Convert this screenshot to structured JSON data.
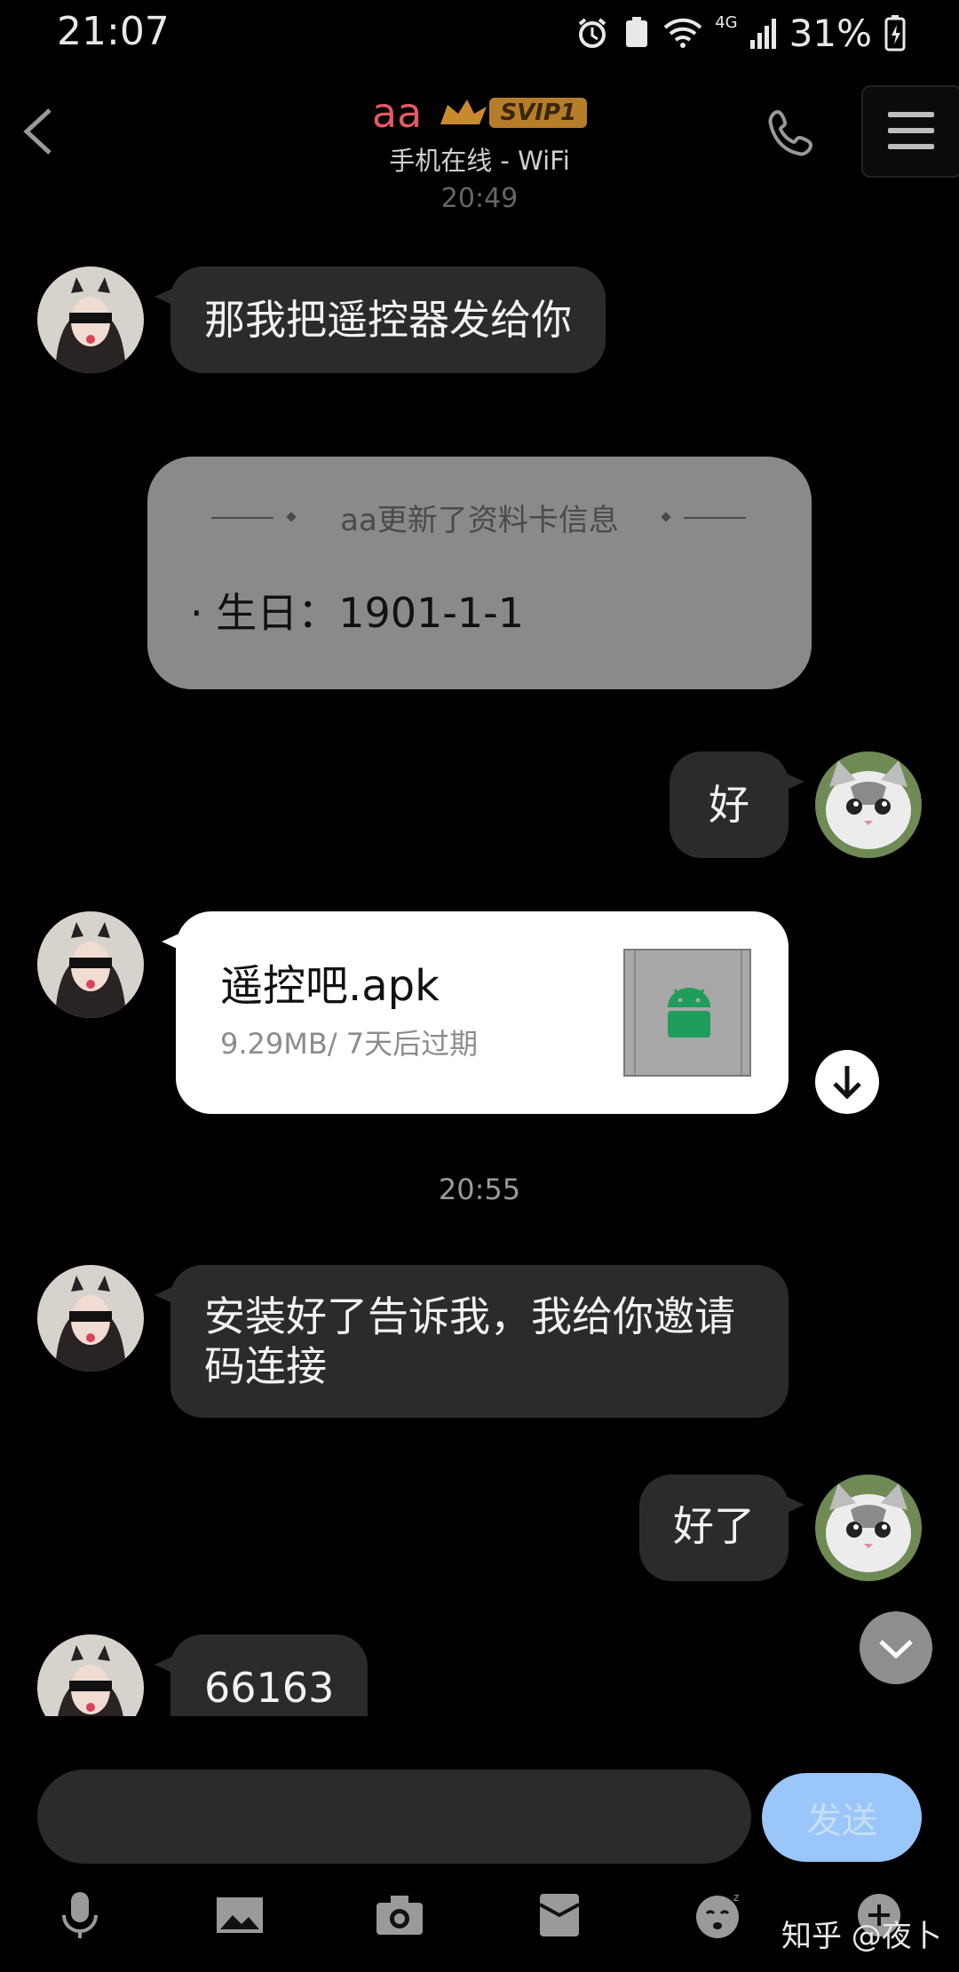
{
  "status_bar": {
    "time": "21:07",
    "network": "4G",
    "battery": "31%"
  },
  "header": {
    "title": "aa",
    "badge": "SVIP1",
    "subtitle": "手机在线 - WiFi",
    "back_icon": "chevron-left-icon",
    "call_icon": "phone-icon",
    "menu_icon": "hamburger-icon"
  },
  "faded_time": "20:49",
  "messages": [
    {
      "side": "left",
      "type": "text",
      "text": "那我把遥控器发给你"
    },
    {
      "type": "profile_update",
      "title": "aa更新了资料卡信息",
      "body": "· 生日：1901-1-1"
    },
    {
      "side": "right",
      "type": "text",
      "text": "好"
    },
    {
      "side": "left",
      "type": "file",
      "name": "遥控吧.apk",
      "meta": "9.29MB/ 7天后过期",
      "icon": "android-icon"
    },
    {
      "type": "time",
      "text": "20:55"
    },
    {
      "side": "left",
      "type": "text",
      "text_line1": "安装好了告诉我，我给你邀请",
      "text_line2": "码连接"
    },
    {
      "side": "right",
      "type": "text",
      "text": "好了"
    },
    {
      "side": "left",
      "type": "text",
      "text": "66163"
    }
  ],
  "input": {
    "send_label": "发送",
    "placeholder": ""
  },
  "toolbar": [
    "microphone-icon",
    "image-icon",
    "camera-icon",
    "red-envelope-icon",
    "emoji-icon",
    "plus-icon"
  ],
  "watermark": "知乎 @夜卜",
  "colors": {
    "background": "#000000",
    "bubble": "#2b2b2b",
    "accent_name": "#e15a64",
    "send_button": "#9ac6fa",
    "file_icon": "#1e9e5a"
  }
}
